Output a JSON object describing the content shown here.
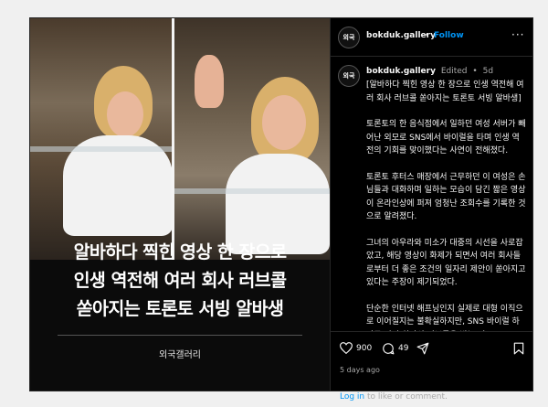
{
  "media": {
    "headline_lines": [
      "알바하다 찍힌 영상 한 장으로",
      "인생 역전해 여러 회사 러브콜",
      "쏟아지는 토론토 서빙 알바생"
    ],
    "brand": "외국갤러리"
  },
  "header": {
    "avatar_text": "외국",
    "username": "bokduk.gallery",
    "separator": "•",
    "follow_label": "Follow",
    "more_label": "···"
  },
  "caption": {
    "avatar_text": "외국",
    "username": "bokduk.gallery",
    "edited": "Edited",
    "separator": "•",
    "age": "5d",
    "paragraphs": [
      "[알바하다 찍힌 영상 한 장으로 인생 역전해 여러 회사 러브콜 쏟아지는 토론토 서빙 알바생]",
      "토론토의 한 음식점에서 일하던 여성 서버가 빼어난 외모로 SNS에서 바이럴을 타며 인생 역전의 기회를 맞이했다는 사연이 전해졌다.",
      "토론토 후터스 매장에서 근무하던 이 여성은 손님들과 대화하며 일하는 모습이 담긴 짧은 영상이 온라인상에 퍼져 엄청난 조회수를 기록한 것으로 알려졌다.",
      "그녀의 아우라와 미소가 대중의 시선을 사로잡았고, 해당 영상이 화제가 되면서 여러 회사들로부터 더 좋은 조건의 일자리 제안이 쏟아지고 있다는 주장이 제기되었다.",
      "단순한 인터넷 해프닝인지 실제로 대형 이직으로 이어질지는 불확실하지만, SNS 바이럴 하나로 여러 회사의 러브콜을 받는 이"
    ]
  },
  "actions": {
    "likes": "900",
    "comments": "49",
    "time_ago": "5 days ago",
    "login_link": "Log in",
    "login_rest": " to like or comment."
  },
  "colors": {
    "background": "#000000",
    "accent": "#0095f6",
    "muted": "#a8a8a8"
  }
}
